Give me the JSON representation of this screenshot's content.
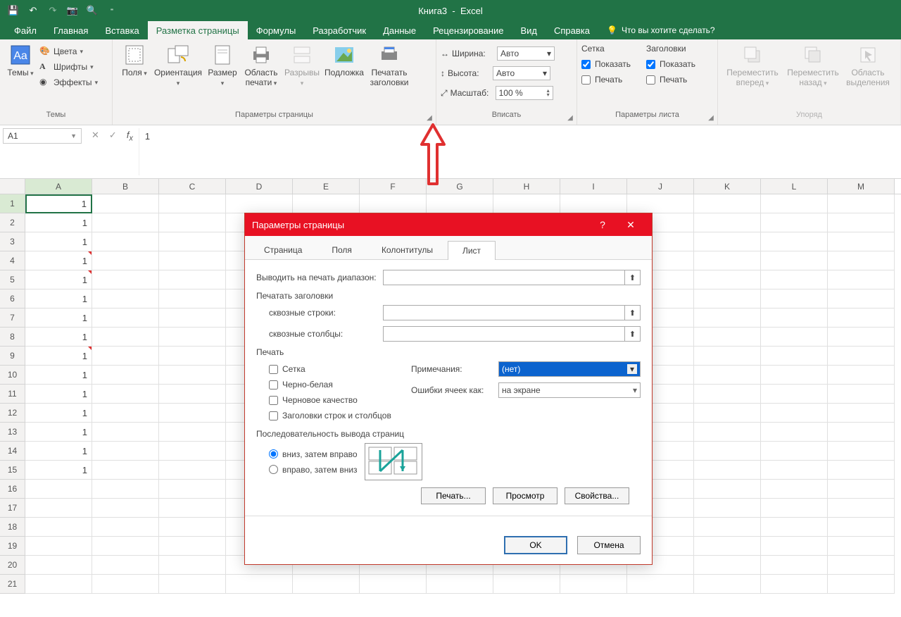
{
  "title_doc": "Книга3",
  "title_app": "Excel",
  "tabs": {
    "file": "Файл",
    "home": "Главная",
    "insert": "Вставка",
    "pagelayout": "Разметка страницы",
    "formulas": "Формулы",
    "developer": "Разработчик",
    "data": "Данные",
    "review": "Рецензирование",
    "view": "Вид",
    "help": "Справка",
    "tellme": "Что вы хотите сделать?"
  },
  "ribbon": {
    "themes": {
      "themes": "Темы",
      "colors": "Цвета",
      "fonts": "Шрифты",
      "effects": "Эффекты",
      "group": "Темы"
    },
    "pagesetup": {
      "margins": "Поля",
      "orientation": "Ориентация",
      "size": "Размер",
      "printarea": "Область печати",
      "breaks": "Разрывы",
      "background": "Подложка",
      "printtitles": "Печатать заголовки",
      "group": "Параметры страницы"
    },
    "fit": {
      "width_l": "Ширина:",
      "width_v": "Авто",
      "height_l": "Высота:",
      "height_v": "Авто",
      "scale_l": "Масштаб:",
      "scale_v": "100 %",
      "group": "Вписать"
    },
    "sheet": {
      "grid_h": "Сетка",
      "head_h": "Заголовки",
      "show": "Показать",
      "print": "Печать",
      "group": "Параметры листа"
    },
    "arrange": {
      "forward": "Переместить вперед",
      "backward": "Переместить назад",
      "selpane": "Область выделения",
      "group": "Упоряд"
    }
  },
  "namebox": "A1",
  "fx_value": "1",
  "columns": [
    "A",
    "B",
    "C",
    "D",
    "E",
    "F",
    "G",
    "H",
    "I",
    "J",
    "K",
    "L",
    "M"
  ],
  "rows": [
    1,
    2,
    3,
    4,
    5,
    6,
    7,
    8,
    9,
    10,
    11,
    12,
    13,
    14,
    15,
    16,
    17,
    18,
    19,
    20,
    21
  ],
  "colA": [
    "1",
    "1",
    "1",
    "1",
    "1",
    "1",
    "1",
    "1",
    "1",
    "1",
    "1",
    "1",
    "1",
    "1",
    "1",
    "",
    "",
    "",
    "",
    "",
    ""
  ],
  "redmarks": [
    4,
    5,
    9
  ],
  "dialog": {
    "title": "Параметры страницы",
    "tabs": {
      "page": "Страница",
      "margins": "Поля",
      "headerfooter": "Колонтитулы",
      "sheet": "Лист"
    },
    "print_range": "Выводить на печать диапазон:",
    "print_titles": "Печатать заголовки",
    "rows_repeat": "сквозные строки:",
    "cols_repeat": "сквозные столбцы:",
    "print_section": "Печать",
    "grid": "Сетка",
    "bw": "Черно-белая",
    "draft": "Черновое качество",
    "rowcolhead": "Заголовки строк и столбцов",
    "comments_l": "Примечания:",
    "comments_v": "(нет)",
    "errors_l": "Ошибки ячеек как:",
    "errors_v": "на экране",
    "order_section": "Последовательность вывода страниц",
    "order_down": "вниз, затем вправо",
    "order_over": "вправо, затем вниз",
    "btn_print": "Печать...",
    "btn_preview": "Просмотр",
    "btn_options": "Свойства...",
    "btn_ok": "OK",
    "btn_cancel": "Отмена"
  }
}
